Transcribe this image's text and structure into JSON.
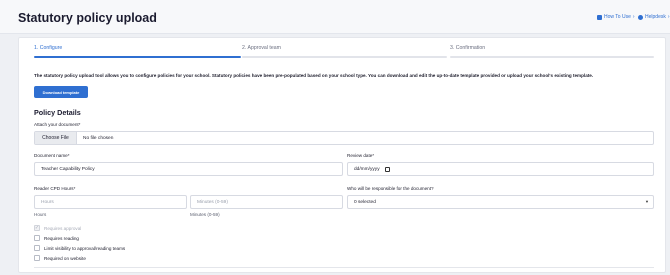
{
  "header": {
    "title": "Statutory policy upload",
    "links": [
      {
        "label": "How To Use",
        "icon": "book-icon"
      },
      {
        "label": "Helpdesk",
        "icon": "help-icon"
      }
    ]
  },
  "steps": [
    {
      "label": "1. Configure",
      "active": true
    },
    {
      "label": "2. Approval team",
      "active": false
    },
    {
      "label": "3. Confirmation",
      "active": false
    }
  ],
  "intro": "The statutory policy upload tool allows you to configure policies for your school. Statutory policies have been pre-populated based on your school type. You can download and edit the up-to-date template provided or upload your school's existing template.",
  "download_button": "Download template",
  "section_title": "Policy Details",
  "attach": {
    "label": "Attach your document*",
    "button": "Choose File",
    "status": "No file chosen"
  },
  "document_name": {
    "label": "Document name*",
    "value": "Teacher Capability Policy"
  },
  "review_date": {
    "label": "Review date*",
    "placeholder": "dd/mm/yyyy"
  },
  "cpd": {
    "label": "Reader CPD Hours*",
    "hours_placeholder": "Hours",
    "minutes_placeholder": "Minutes (0-59)",
    "hours_caption": "Hours",
    "minutes_caption": "Minutes (0-59)"
  },
  "responsible": {
    "label": "Who will be responsible for the document?",
    "value": "0 selected"
  },
  "checkboxes": [
    {
      "label": "Requires approval",
      "checked": true,
      "disabled": true
    },
    {
      "label": "Requires reading",
      "checked": false,
      "disabled": false
    },
    {
      "label": "Limit visibility to approval/reading teams",
      "checked": false,
      "disabled": false
    },
    {
      "label": "Required on website",
      "checked": false,
      "disabled": false
    }
  ],
  "colors": {
    "accent": "#2f6fd1",
    "background": "#eef0f4"
  }
}
